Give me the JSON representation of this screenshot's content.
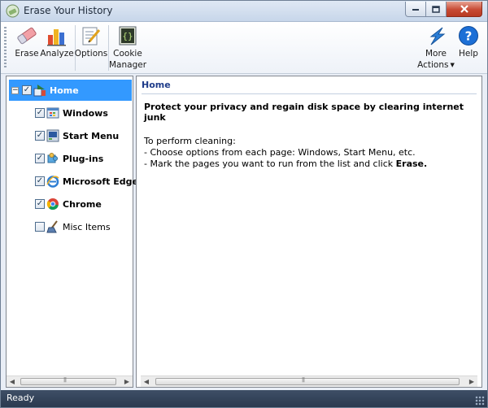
{
  "window": {
    "title": "Erase Your History"
  },
  "toolbar": {
    "erase": "Erase",
    "analyze": "Analyze",
    "options": "Options",
    "cookie_line1": "Cookie",
    "cookie_line2": "Manager",
    "more_line1": "More",
    "more_line2": "Actions",
    "help": "Help"
  },
  "tree": {
    "items": [
      {
        "label": "Home",
        "checked": true
      },
      {
        "label": "Windows",
        "checked": true
      },
      {
        "label": "Start Menu",
        "checked": true
      },
      {
        "label": "Plug-ins",
        "checked": true
      },
      {
        "label": "Microsoft Edge/IE",
        "checked": true
      },
      {
        "label": "Chrome",
        "checked": true
      },
      {
        "label": "Misc Items",
        "checked": false
      }
    ]
  },
  "content": {
    "title": "Home",
    "headline": "Protect your privacy and regain disk space by clearing internet junk",
    "instr_intro": "To perform cleaning:",
    "instr_line1": "- Choose options from each page: Windows, Start Menu, etc.",
    "instr_line2": "- Mark the pages you want to run from the list and click ",
    "instr_erase": "Erase."
  },
  "status": {
    "text": "Ready"
  },
  "colors": {
    "selection": "#3399ff",
    "statusbar": "#2f3e54",
    "accent_blue": "#1f3c8a"
  }
}
